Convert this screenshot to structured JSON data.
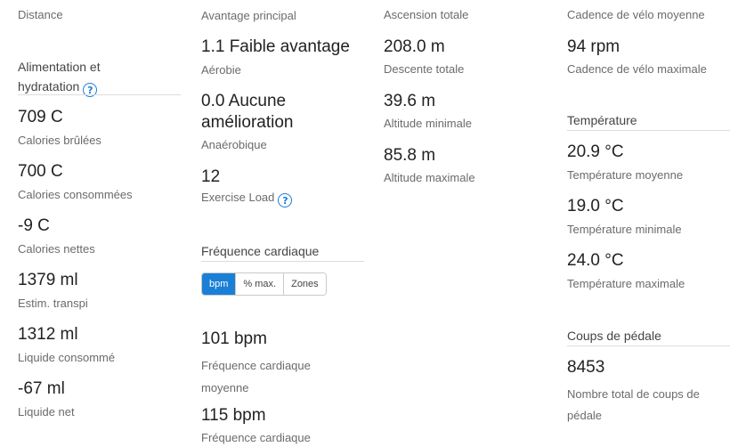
{
  "col1": {
    "distance_label": "Distance",
    "section_title_line1": "Alimentation et",
    "section_title_line2": "hydratation",
    "stats": [
      {
        "value": "709 C",
        "label": "Calories brûlées"
      },
      {
        "value": "700 C",
        "label": "Calories consommées"
      },
      {
        "value": "-9 C",
        "label": "Calories nettes"
      },
      {
        "value": "1379 ml",
        "label": "Estim. transpi"
      },
      {
        "value": "1312 ml",
        "label": "Liquide consommé"
      },
      {
        "value": "-67 ml",
        "label": "Liquide net"
      }
    ]
  },
  "col2": {
    "top_label": "Avantage principal",
    "stats": [
      {
        "value": "1.1 Faible avantage",
        "label": "Aérobie"
      },
      {
        "value_line1": "0.0 Aucune",
        "value_line2": "amélioration",
        "label": "Anaérobique"
      },
      {
        "value": "12",
        "label": "Exercise Load"
      }
    ],
    "hr_title": "Fréquence cardiaque",
    "hr_tabs": [
      "bpm",
      "% max.",
      "Zones"
    ],
    "hr_stats": [
      {
        "value": "101 bpm",
        "label_line1": "Fréquence cardiaque",
        "label_line2": "moyenne"
      },
      {
        "value": "115 bpm",
        "label_line1": "Fréquence cardiaque"
      }
    ]
  },
  "col3": {
    "top_label": "Ascension totale",
    "stats": [
      {
        "value": "208.0 m",
        "label": "Descente totale"
      },
      {
        "value": "39.6 m",
        "label": "Altitude minimale"
      },
      {
        "value": "85.8 m",
        "label": "Altitude maximale"
      }
    ]
  },
  "col4": {
    "top_label": "Cadence de vélo moyenne",
    "cadence": {
      "value": "94 rpm",
      "label": "Cadence de vélo maximale"
    },
    "temp_title": "Température",
    "temps": [
      {
        "value": "20.9 °C",
        "label": "Température moyenne"
      },
      {
        "value": "19.0 °C",
        "label": "Température minimale"
      },
      {
        "value": "24.0 °C",
        "label": "Température maximale"
      }
    ],
    "pedal_title": "Coups de pédale",
    "pedal": {
      "value": "8453",
      "label_line1": "Nombre total de coups de",
      "label_line2": "pédale"
    }
  },
  "colors": {
    "accent": "#1a7fd6"
  },
  "icons": {
    "help": "question-circle-icon"
  }
}
